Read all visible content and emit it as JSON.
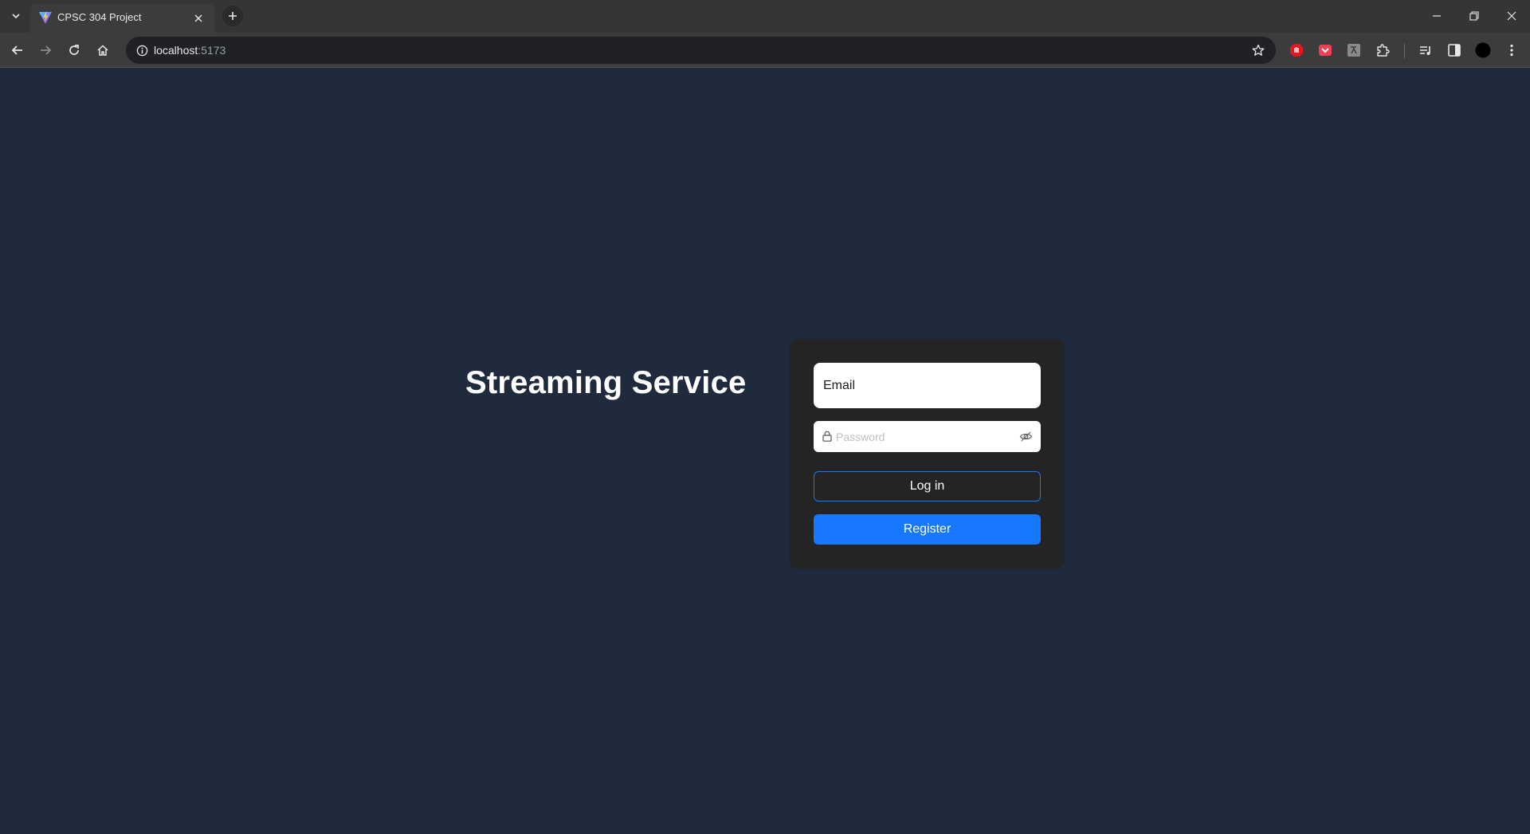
{
  "browser": {
    "tab": {
      "title": "CPSC 304 Project",
      "favicon": "vite-icon"
    },
    "address": {
      "host": "localhost",
      "port": ":5173"
    },
    "icons": [
      "tab-search-icon",
      "close-icon",
      "new-tab-icon",
      "minimize-icon",
      "restore-icon",
      "window-close-icon",
      "back-icon",
      "forward-icon",
      "reload-icon",
      "home-icon",
      "site-info-icon",
      "bookmark-star-icon",
      "extension-adblock-icon",
      "extension-pocket-icon",
      "extension-translate-icon",
      "extensions-puzzle-icon",
      "media-controls-icon",
      "side-panel-icon",
      "profile-avatar-icon",
      "menu-kebab-icon"
    ]
  },
  "page": {
    "title": "Streaming Service",
    "form": {
      "email_placeholder": "Email",
      "password_placeholder": "Password",
      "login_label": "Log in",
      "register_label": "Register"
    }
  },
  "colors": {
    "page_bg": "#1f2a3c",
    "card_bg": "#242424",
    "primary": "#1677ff",
    "chrome_tabstrip": "#353535",
    "chrome_toolbar": "#3c3c3c"
  }
}
